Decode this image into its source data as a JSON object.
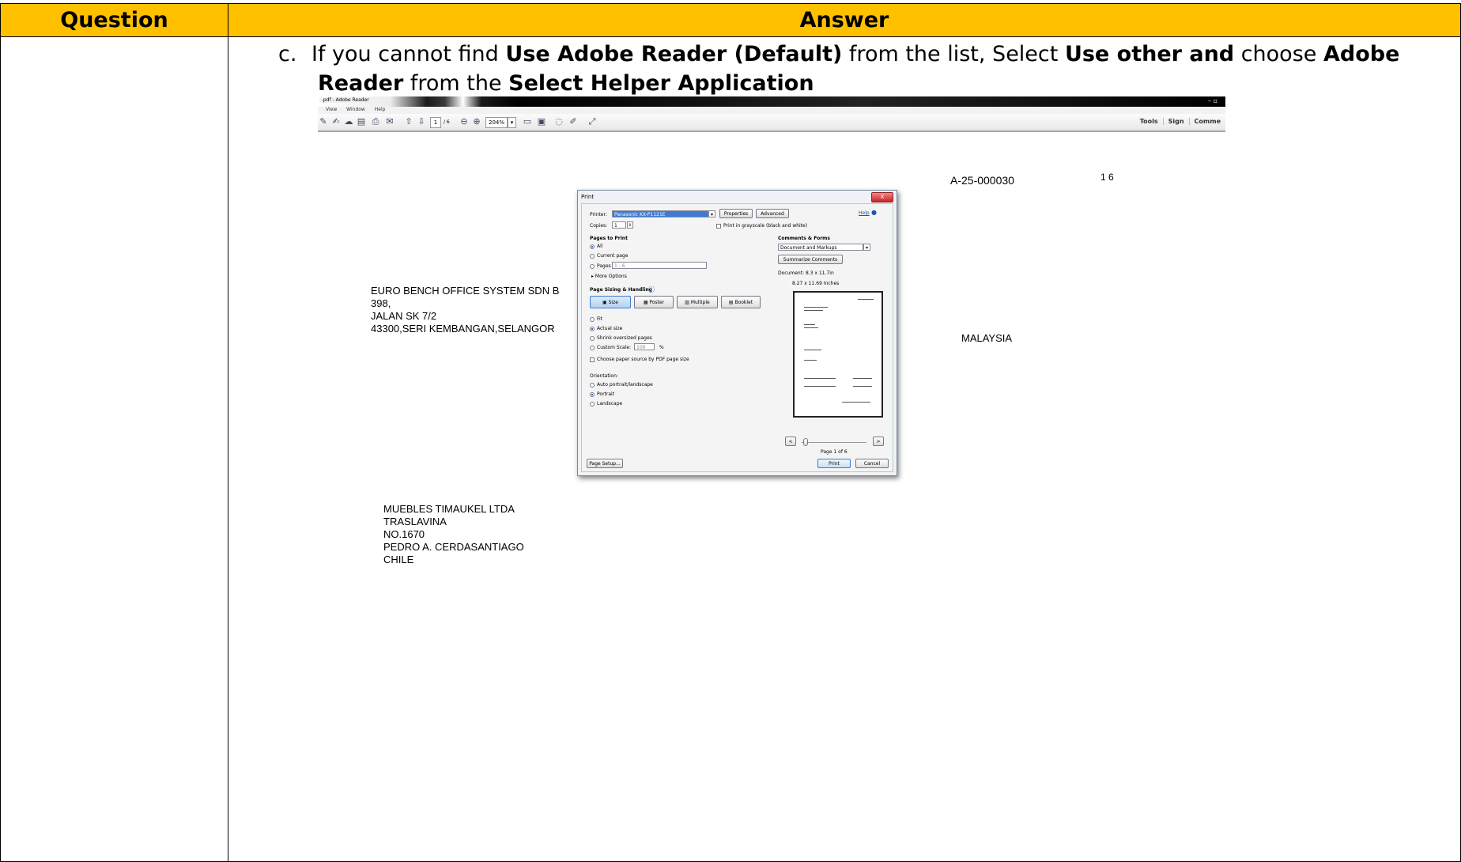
{
  "table": {
    "header_question": "Question",
    "header_answer": "Answer"
  },
  "instruction": {
    "label": "c.",
    "t1": "If you cannot find ",
    "b1": "Use Adobe Reader (Default)",
    "t2": " from the list, Select ",
    "b2": "Use other and",
    "t3": " choose ",
    "b3": "Adobe",
    "b4": "Reader",
    "t4": " from the ",
    "b5": "Select Helper Application"
  },
  "reader": {
    "title": ".pdf - Adobe Reader",
    "menu": [
      "View",
      "Window",
      "Help"
    ],
    "page_current": "1",
    "page_total": "/ 6",
    "zoom": "204%",
    "right_tools": [
      "Tools",
      "Sign",
      "Comme"
    ]
  },
  "document": {
    "ref": "A-25-000030",
    "page_info": "1  6",
    "sender": [
      "EURO BENCH OFFICE SYSTEM SDN B",
      "398,",
      "JALAN SK 7/2",
      "43300,SERI KEMBANGAN,SELANGOR"
    ],
    "country": "MALAYSIA",
    "recipient": [
      "MUEBLES TIMAUKEL LTDA",
      "TRASLAVINA",
      "NO.1670",
      "PEDRO A. CERDASANTIAGO",
      "CHILE"
    ]
  },
  "print_dialog": {
    "title": "Print",
    "close": "X",
    "printer_label": "Printer:",
    "printer_value": "Panasonic KX-P1121E",
    "properties": "Properties",
    "advanced": "Advanced",
    "help": "Help",
    "copies_label": "Copies:",
    "copies_value": "1",
    "grayscale": "Print in grayscale (black and white)",
    "pages_to_print": "Pages to Print",
    "all": "All",
    "current_page": "Current page",
    "pages": "Pages",
    "pages_value": "1 - 6",
    "more_options": "More Options",
    "sizing": "Page Sizing & Handling",
    "size_btn": "Size",
    "poster_btn": "Poster",
    "multiple_btn": "Multiple",
    "booklet_btn": "Booklet",
    "fit": "Fit",
    "actual": "Actual size",
    "shrink": "Shrink oversized pages",
    "custom_scale": "Custom Scale:",
    "custom_value": "100",
    "pct": "%",
    "paper_source": "Choose paper source by PDF page size",
    "orientation": "Orientation:",
    "auto": "Auto portrait/landscape",
    "portrait": "Portrait",
    "landscape": "Landscape",
    "comments_forms": "Comments & Forms",
    "comments_value": "Document and Markups",
    "summarize": "Summarize Comments",
    "document_size": "Document: 8.3 x 11.7in",
    "paper_size": "8.27 x 11.69 Inches",
    "page_of": "Page 1 of 6",
    "page_setup": "Page Setup...",
    "print_btn": "Print",
    "cancel_btn": "Cancel"
  }
}
